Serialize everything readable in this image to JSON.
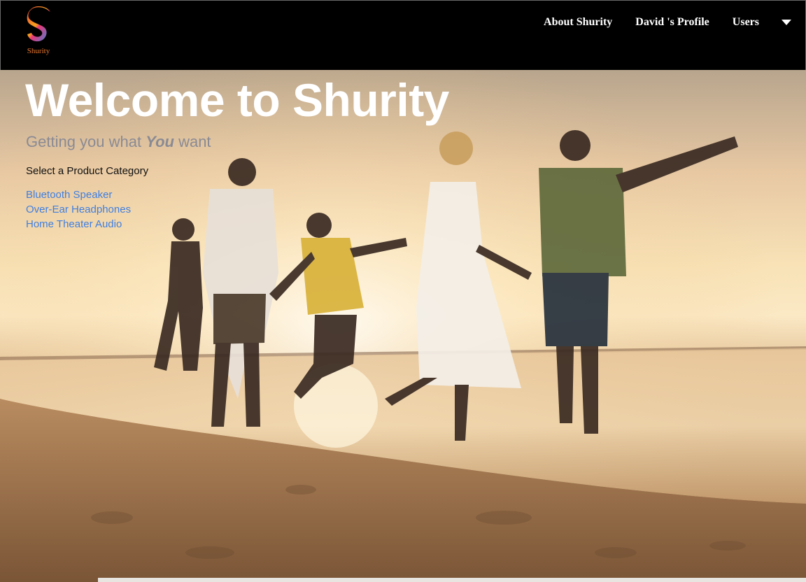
{
  "brand": {
    "name": "Shurity",
    "logo_icon": "shurity-s-logo-icon",
    "colors": {
      "logo_text": "#e8772e",
      "link": "#3f7fe0",
      "nav_bg": "#000000"
    }
  },
  "nav": {
    "items": [
      {
        "label": "About Shurity"
      },
      {
        "label": "David 's Profile"
      },
      {
        "label": "Users"
      }
    ],
    "dropdown_icon": "caret-down-icon"
  },
  "hero": {
    "title": "Welcome to Shurity",
    "subtitle_before": "Getting you what ",
    "subtitle_emphasis": "You",
    "subtitle_after": " want",
    "image": "family-jumping-on-beach-at-sunset"
  },
  "categories": {
    "heading": "Select a Product Category",
    "items": [
      {
        "label": "Bluetooth Speaker"
      },
      {
        "label": "Over-Ear Headphones"
      },
      {
        "label": "Home Theater Audio"
      }
    ]
  }
}
